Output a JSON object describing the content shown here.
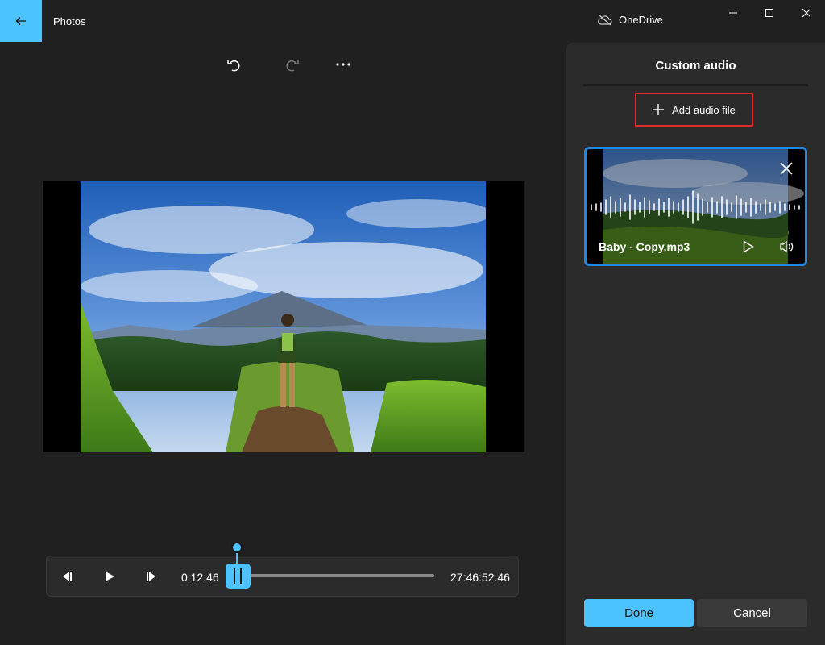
{
  "app": {
    "title": "Photos"
  },
  "titlebar": {
    "cloud_label": "OneDrive"
  },
  "toolbar": {
    "undo_icon": "undo-icon",
    "redo_icon": "redo-icon",
    "more_icon": "more-icon"
  },
  "player": {
    "current_time": "0:12.46",
    "total_time": "27:46:52.46",
    "progress": 0.0
  },
  "panel": {
    "title": "Custom audio",
    "add_audio_label": "Add audio file",
    "audio_items": [
      {
        "name": "Baby - Copy.mp3"
      }
    ],
    "done_label": "Done",
    "cancel_label": "Cancel"
  },
  "colors": {
    "accent": "#4cc2ff",
    "highlight": "#e02b2b",
    "card_border": "#1e88e5",
    "background": "#202020",
    "panel": "#2b2b2b"
  }
}
